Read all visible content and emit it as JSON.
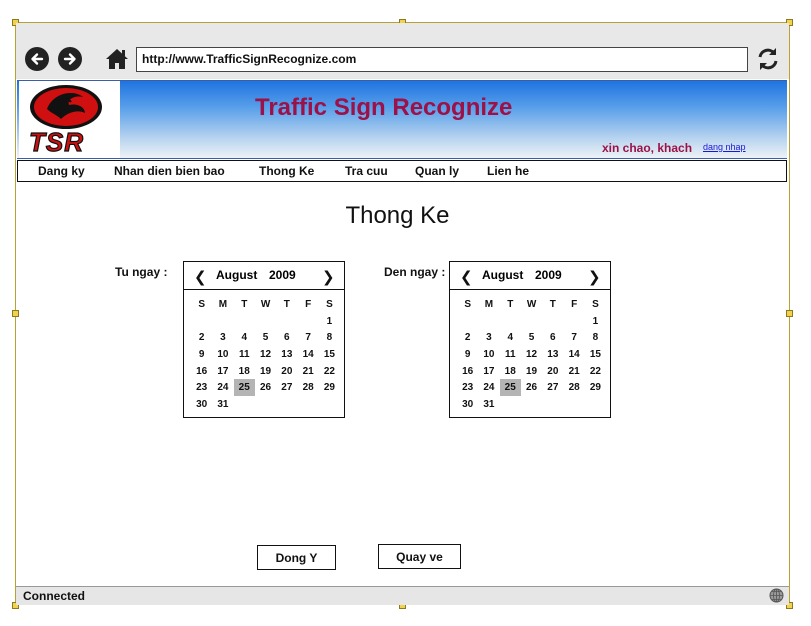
{
  "browser": {
    "url": "http://www.TrafficSignRecognize.com",
    "status": "Connected"
  },
  "header": {
    "logo_text": "TSR",
    "title": "Traffic Sign Recognize",
    "greeting": "xin chao, khach",
    "login_link": "dang nhap"
  },
  "menu": [
    {
      "label": "Dang ky"
    },
    {
      "label": "Nhan dien bien bao"
    },
    {
      "label": "Thong Ke"
    },
    {
      "label": "Tra cuu"
    },
    {
      "label": "Quan ly"
    },
    {
      "label": "Lien he"
    }
  ],
  "main": {
    "title": "Thong Ke",
    "from_label": "Tu ngay :",
    "to_label": "Den ngay :"
  },
  "calendars": [
    {
      "month": "August",
      "year": "2009",
      "selected": "25"
    },
    {
      "month": "August",
      "year": "2009",
      "selected": "25"
    }
  ],
  "weekdays": [
    "S",
    "M",
    "T",
    "W",
    "T",
    "F",
    "S"
  ],
  "days": [
    "",
    "",
    "",
    "",
    "",
    "",
    "1",
    "2",
    "3",
    "4",
    "5",
    "6",
    "7",
    "8",
    "9",
    "10",
    "11",
    "12",
    "13",
    "14",
    "15",
    "16",
    "17",
    "18",
    "19",
    "20",
    "21",
    "22",
    "23",
    "24",
    "25",
    "26",
    "27",
    "28",
    "29",
    "30",
    "31"
  ],
  "buttons": {
    "ok": "Dong Y",
    "back": "Quay ve"
  },
  "colors": {
    "title": "#9c1148",
    "banner_top": "#1f74e0",
    "link": "#1818d8"
  }
}
